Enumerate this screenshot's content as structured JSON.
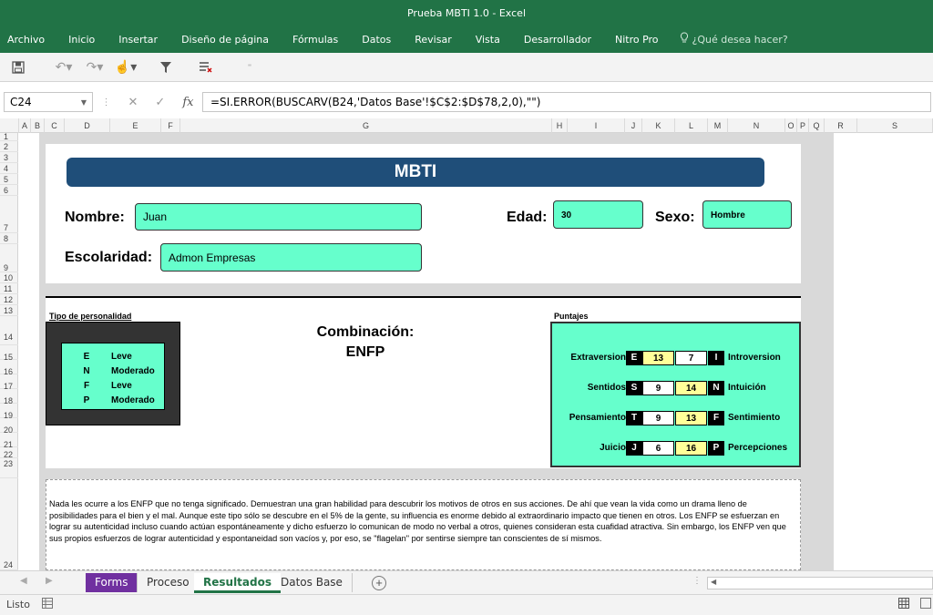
{
  "window": {
    "title": "Prueba MBTI 1.0 - Excel"
  },
  "ribbon": {
    "tabs": [
      "Archivo",
      "Inicio",
      "Insertar",
      "Diseño de página",
      "Fórmulas",
      "Datos",
      "Revisar",
      "Vista",
      "Desarrollador",
      "Nitro Pro"
    ],
    "tell_me": "¿Qué desea hacer?"
  },
  "formula_bar": {
    "name_box": "C24",
    "formula": "=SI.ERROR(BUSCARV(B24,'Datos Base'!$C$2:$D$78,2,0),\"\")"
  },
  "columns": [
    "A",
    "B",
    "C",
    "D",
    "E",
    "F",
    "G",
    "H",
    "I",
    "J",
    "K",
    "L",
    "M",
    "N",
    "O",
    "P",
    "Q",
    "R",
    "S"
  ],
  "rows": [
    "1",
    "2",
    "3",
    "4",
    "5",
    "6",
    "7",
    "8",
    "9",
    "10",
    "11",
    "12",
    "13",
    "14",
    "15",
    "16",
    "17",
    "18",
    "19",
    "20",
    "21",
    "22",
    "23",
    "24"
  ],
  "form": {
    "title": "MBTI",
    "nombre_label": "Nombre:",
    "nombre_value": "Juan",
    "edad_label": "Edad:",
    "edad_value": "30",
    "sexo_label": "Sexo:",
    "sexo_value": "Hombre",
    "escolaridad_label": "Escolaridad:",
    "escolaridad_value": "Admon Empresas"
  },
  "tipo": {
    "title": "Tipo de personalidad",
    "rows": [
      {
        "letter": "E",
        "level": "Leve"
      },
      {
        "letter": "N",
        "level": "Moderado"
      },
      {
        "letter": "F",
        "level": "Leve"
      },
      {
        "letter": "P",
        "level": "Moderado"
      }
    ]
  },
  "combinacion": {
    "label": "Combinación:",
    "value": "ENFP"
  },
  "puntajes": {
    "title": "Puntajes",
    "rows": [
      {
        "left_name": "Extraversion",
        "left_key": "E",
        "left_score": "13",
        "right_score": "7",
        "right_key": "I",
        "right_name": "Introversion",
        "highlight": "left"
      },
      {
        "left_name": "Sentidos",
        "left_key": "S",
        "left_score": "9",
        "right_score": "14",
        "right_key": "N",
        "right_name": "Intuición",
        "highlight": "right"
      },
      {
        "left_name": "Pensamiento",
        "left_key": "T",
        "left_score": "9",
        "right_score": "13",
        "right_key": "F",
        "right_name": "Sentimiento",
        "highlight": "right"
      },
      {
        "left_name": "Juicio",
        "left_key": "J",
        "left_score": "6",
        "right_score": "16",
        "right_key": "P",
        "right_name": "Percepciones",
        "highlight": "right"
      }
    ]
  },
  "description": "Nada les ocurre a los ENFP que no tenga significado.  Demuestran una gran habilidad para descubrir los motivos de otros en sus acciones.  De ahí que vean la vida como un drama lleno de posibilidades para el bien y el mal.  Aunque este tipo sólo se descubre en el 5% de la gente, su influencia es enorme debido al extraordinario impacto que tienen en otros.  Los ENFP se esfuerzan en lograr su autenticidad incluso cuando actúan espontáneamente y dicho esfuerzo lo comunican de modo no verbal a otros, quienes consideran esta cuafidad atractiva.  Sin embargo, los ENFP ven que sus propios esfuerzos de lograr autenticidad y espontaneidad son vacíos y, por eso, se \"flagelan\" por sentirse siempre tan conscientes de sí mismos.",
  "sheet_tabs": [
    "Forms",
    "Proceso",
    "Resultados",
    "Datos Base"
  ],
  "status": {
    "text": "Listo"
  },
  "colors": {
    "excel_green": "#217346",
    "mint": "#66ffcc",
    "navy": "#1f4e79",
    "highlight_yellow": "#ffff99",
    "forms_tab": "#7030a0"
  }
}
